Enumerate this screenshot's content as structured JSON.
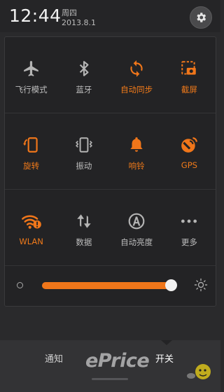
{
  "status_bar": {
    "time": "12:44",
    "weekday": "周四",
    "date": "2013.8.1"
  },
  "toggles": [
    [
      {
        "label": "飞行模式",
        "icon": "airplane-icon",
        "on": false
      },
      {
        "label": "蓝牙",
        "icon": "bluetooth-icon",
        "on": false
      },
      {
        "label": "自动同步",
        "icon": "sync-icon",
        "on": true
      },
      {
        "label": "截屏",
        "icon": "screenshot-icon",
        "on": true
      }
    ],
    [
      {
        "label": "旋转",
        "icon": "rotate-icon",
        "on": true
      },
      {
        "label": "振动",
        "icon": "vibrate-icon",
        "on": false
      },
      {
        "label": "响铃",
        "icon": "bell-icon",
        "on": true
      },
      {
        "label": "GPS",
        "icon": "gps-icon",
        "on": true
      }
    ],
    [
      {
        "label": "WLAN",
        "icon": "wifi-icon",
        "on": true
      },
      {
        "label": "数据",
        "icon": "data-icon",
        "on": false
      },
      {
        "label": "自动亮度",
        "icon": "auto-brightness-icon",
        "on": false
      },
      {
        "label": "更多",
        "icon": "more-icon",
        "on": false
      }
    ]
  ],
  "brightness": {
    "level": 0.99
  },
  "tabs": {
    "notify": "通知",
    "toggles": "开关"
  },
  "watermark": {
    "text": "ePrice"
  },
  "colors": {
    "accent": "#f0761a",
    "icon_off": "#b4b4b4"
  }
}
